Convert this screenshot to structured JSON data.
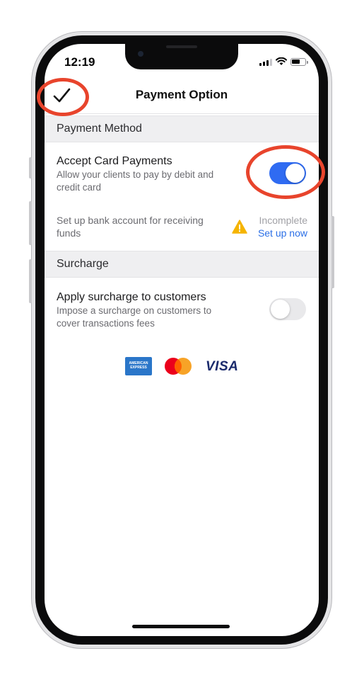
{
  "status_bar": {
    "time": "12:19"
  },
  "nav": {
    "title": "Payment Option",
    "done_icon": "checkmark-icon"
  },
  "sections": {
    "payment_method": "Payment Method",
    "surcharge": "Surcharge"
  },
  "accept_card": {
    "title": "Accept Card Payments",
    "subtitle_line1": "Allow your clients to pay by debit and",
    "subtitle_line2": "credit card",
    "enabled": true
  },
  "bank_setup": {
    "text_line1": "Set up bank account for receiving",
    "text_line2": "funds",
    "status": "Incomplete",
    "action": "Set up now"
  },
  "apply_surcharge": {
    "title": "Apply surcharge to customers",
    "subtitle_line1": "Impose a surcharge on customers to",
    "subtitle_line2": "cover transactions fees",
    "enabled": false
  },
  "card_logos": {
    "amex_line1": "AMERICAN",
    "amex_line2": "EXPRESS",
    "visa": "VISA"
  },
  "colors": {
    "accent": "#2f6bf2",
    "link": "#2b6fe6",
    "warning": "#f5b400",
    "annotation": "#e8442c"
  }
}
